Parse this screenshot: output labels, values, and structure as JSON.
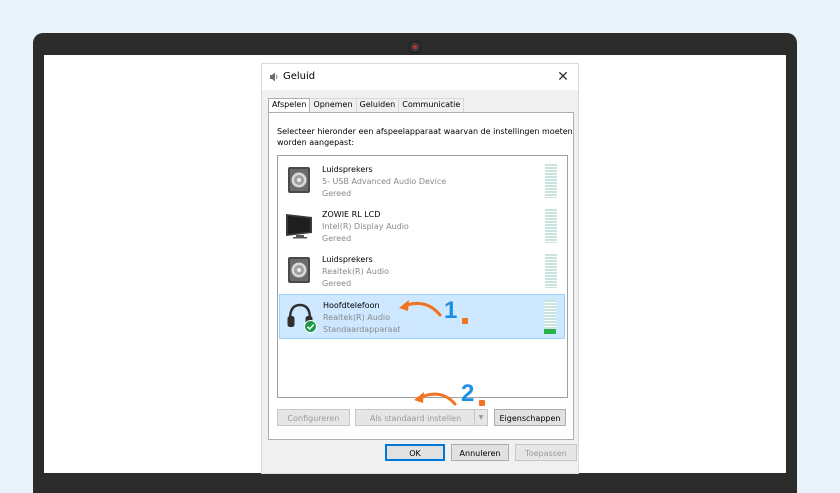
{
  "dialog": {
    "title": "Geluid",
    "tabs": [
      "Afspelen",
      "Opnemen",
      "Geluiden",
      "Communicatie"
    ],
    "active_tab": "Afspelen",
    "instruction": "Selecteer hieronder een afspeelapparaat waarvan de instellingen moeten worden aangepast:",
    "devices": [
      {
        "name": "Luidsprekers",
        "description": "5- USB Advanced Audio Device",
        "status": "Gereed",
        "icon": "speaker-icon",
        "selected": false
      },
      {
        "name": "ZOWIE RL LCD",
        "description": "Intel(R) Display Audio",
        "status": "Gereed",
        "icon": "monitor-icon",
        "selected": false
      },
      {
        "name": "Luidsprekers",
        "description": "Realtek(R) Audio",
        "status": "Gereed",
        "icon": "speaker-icon",
        "selected": false
      },
      {
        "name": "Hoofdtelefoon",
        "description": "Realtek(R) Audio",
        "status": "Standaardapparaat",
        "icon": "headphones-icon",
        "selected": true
      }
    ],
    "buttons": {
      "configure": "Configureren",
      "set_default": "Als standaard instellen",
      "properties": "Eigenschappen",
      "ok": "OK",
      "cancel": "Annuleren",
      "apply": "Toepassen"
    }
  },
  "annotations": {
    "step1": "1",
    "step2": "2",
    "number_color": "#1c8fe3",
    "arrow_color": "#f27321"
  }
}
